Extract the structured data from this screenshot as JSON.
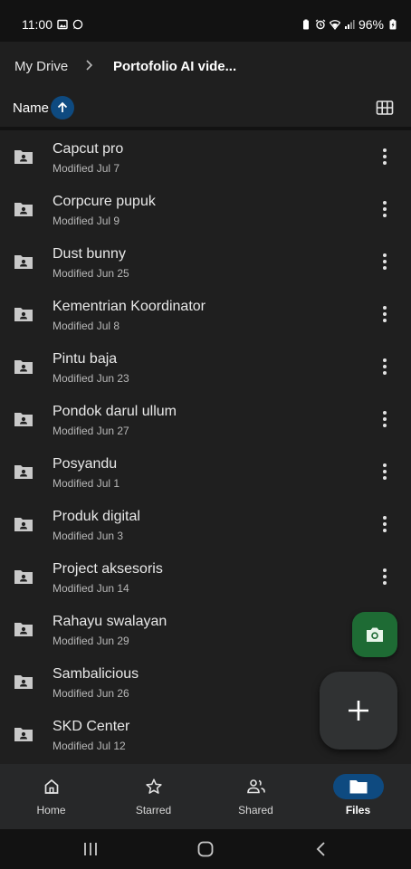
{
  "status_bar": {
    "time": "11:00",
    "battery": "96%",
    "left_icons": [
      "image-icon",
      "whatsapp-icon"
    ],
    "right_icons": [
      "battery-saver-icon",
      "alarm-icon",
      "wifi-icon",
      "signal-icon",
      "battery-icon"
    ]
  },
  "breadcrumb": {
    "root": "My Drive",
    "current": "Portofolio AI vide..."
  },
  "sort": {
    "label": "Name",
    "direction": "ascending"
  },
  "files": [
    {
      "name": "Capcut pro",
      "modified": "Modified Jul 7"
    },
    {
      "name": "Corpcure pupuk",
      "modified": "Modified Jul 9"
    },
    {
      "name": "Dust bunny",
      "modified": "Modified Jun 25"
    },
    {
      "name": "Kementrian Koordinator",
      "modified": "Modified Jul 8"
    },
    {
      "name": "Pintu baja",
      "modified": "Modified Jun 23"
    },
    {
      "name": "Pondok darul ullum",
      "modified": "Modified Jun 27"
    },
    {
      "name": "Posyandu",
      "modified": "Modified Jul 1"
    },
    {
      "name": "Produk digital",
      "modified": "Modified Jun 3"
    },
    {
      "name": "Project aksesoris",
      "modified": "Modified Jun 14"
    },
    {
      "name": "Rahayu swalayan",
      "modified": "Modified Jun 29"
    },
    {
      "name": "Sambalicious",
      "modified": "Modified Jun 26"
    },
    {
      "name": "SKD Center",
      "modified": "Modified Jul 12"
    }
  ],
  "bottom_nav": [
    {
      "label": "Home",
      "icon": "home-icon",
      "active": false
    },
    {
      "label": "Starred",
      "icon": "star-icon",
      "active": false
    },
    {
      "label": "Shared",
      "icon": "people-icon",
      "active": false
    },
    {
      "label": "Files",
      "icon": "folder-icon",
      "active": true
    }
  ],
  "colors": {
    "background": "#1f1f1f",
    "accent": "#0e4a80",
    "camera_fab": "#1e6b34",
    "new_fab": "#303233"
  }
}
